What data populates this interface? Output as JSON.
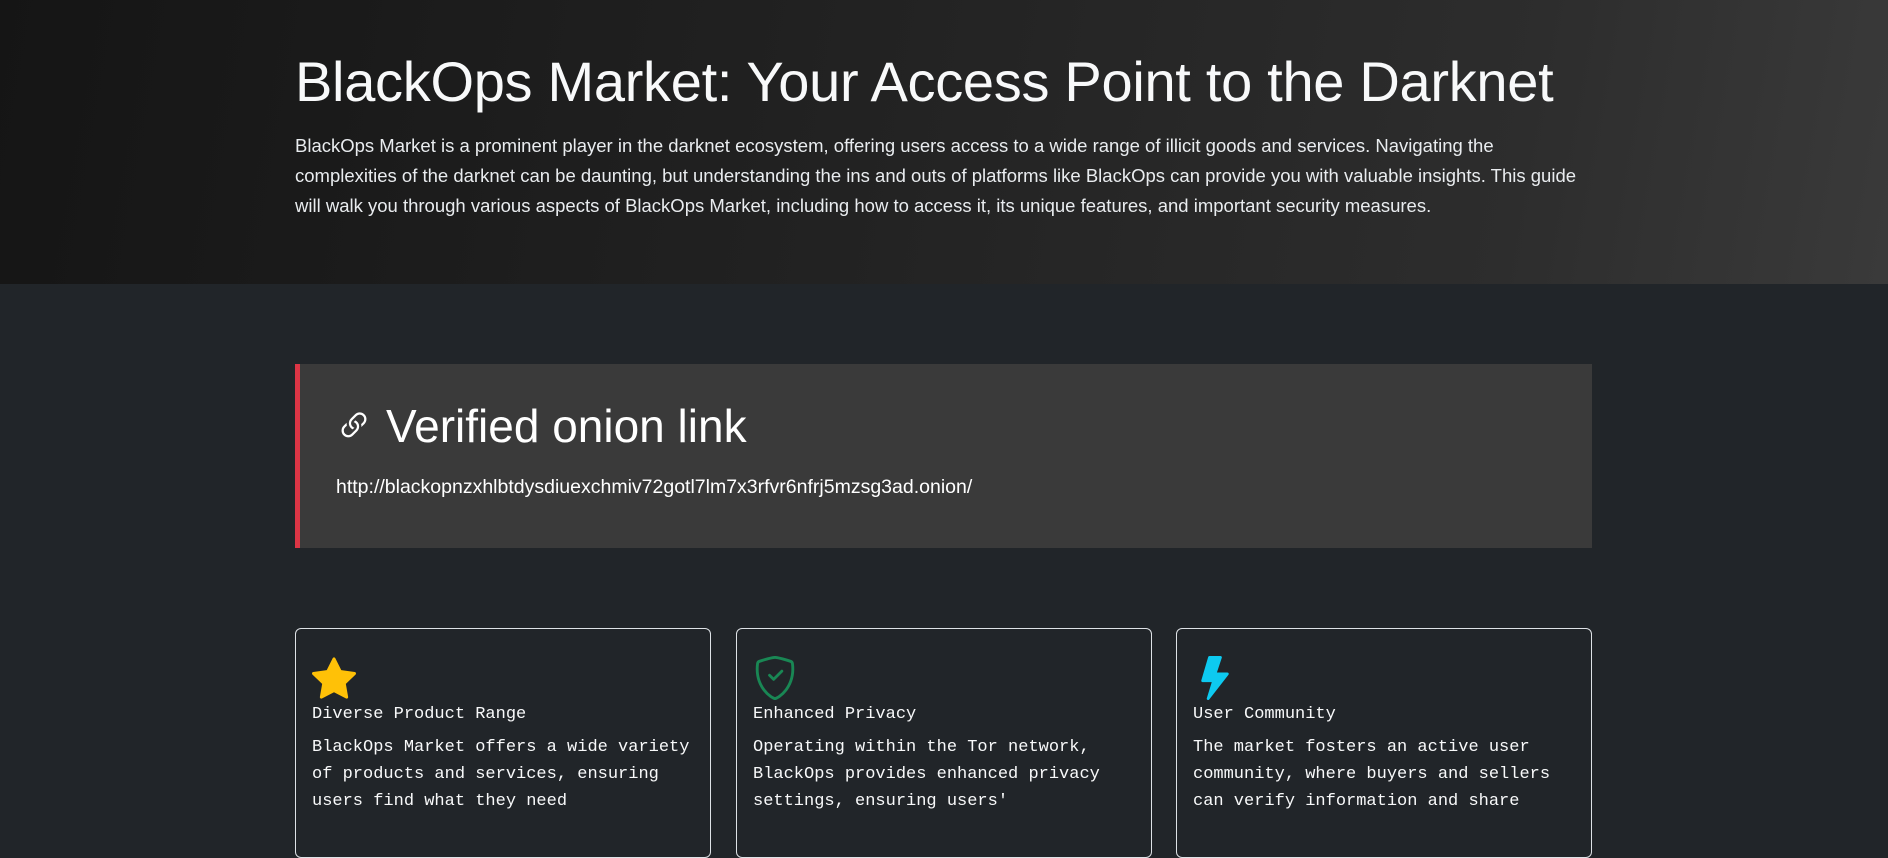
{
  "hero": {
    "title": "BlackOps Market: Your Access Point to the Darknet",
    "description": "BlackOps Market is a prominent player in the darknet ecosystem, offering users access to a wide range of illicit goods and services. Navigating the complexities of the darknet can be daunting, but understanding the ins and outs of platforms like BlackOps can provide you with valuable insights. This guide will walk you through various aspects of BlackOps Market, including how to access it, its unique features, and important security measures."
  },
  "onion": {
    "icon": "link-icon",
    "title": "Verified onion link",
    "url": "http://blackopnzxhlbtdysdiuexchmiv72gotl7lm7x3rfvr6nfrj5mzsg3ad.onion/",
    "accent_color": "#dc3545"
  },
  "features": [
    {
      "icon": "star-icon",
      "icon_color": "#ffc107",
      "title": "Diverse Product Range",
      "text": "BlackOps Market offers a wide variety of products and services, ensuring users find what they need"
    },
    {
      "icon": "shield-check-icon",
      "icon_color": "#198754",
      "title": "Enhanced Privacy",
      "text": "Operating within the Tor network, BlackOps provides enhanced privacy settings, ensuring users'"
    },
    {
      "icon": "lightning-icon",
      "icon_color": "#0dcaf0",
      "title": "User Community",
      "text": "The market fosters an active user community, where buyers and sellers can verify information and share"
    }
  ]
}
